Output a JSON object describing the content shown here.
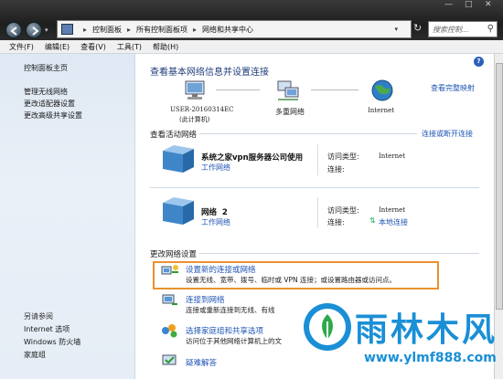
{
  "titlebar": {
    "breadcrumbs": [
      "控制面板",
      "所有控制面板项",
      "网络和共享中心"
    ],
    "search_placeholder": "搜索控制..."
  },
  "menu": [
    "文件(F)",
    "编辑(E)",
    "查看(V)",
    "工具(T)",
    "帮助(H)"
  ],
  "sidebar": {
    "top_links": [
      "控制面板主页",
      "管理无线网络",
      "更改适配器设置",
      "更改高级共享设置"
    ],
    "see_also_title": "另请参阅",
    "see_also_links": [
      "Internet 选项",
      "Windows 防火墙",
      "家庭组"
    ]
  },
  "main": {
    "heading": "查看基本网络信息并设置连接",
    "full_map_link": "查看完整映射",
    "map": {
      "computer_name": "USER-20160314EC",
      "computer_sub": "(此计算机)",
      "network_label": "多重网络",
      "internet_label": "Internet"
    },
    "active_title": "查看活动网络",
    "connect_link": "连接或断开连接",
    "networks": [
      {
        "name": "系统之家vpn服务器公司使用",
        "type_link": "工作网络",
        "access_label": "访问类型:",
        "access_value": "Internet",
        "conn_label": "连接:",
        "conn_value": ""
      },
      {
        "name": "网络  2",
        "type_link": "工作网络",
        "access_label": "访问类型:",
        "access_value": "Internet",
        "conn_label": "连接:",
        "conn_value": "本地连接"
      }
    ],
    "change_title": "更改网络设置",
    "tasks": [
      {
        "title": "设置新的连接或网络",
        "desc": "设置无线、宽带、拨号、临时或 VPN 连接；或设置路由器或访问点。"
      },
      {
        "title": "连接到网络",
        "desc": "连接或重新连接到无线、有线"
      },
      {
        "title": "选择家庭组和共享选项",
        "desc": "访问位于其他网络计算机上的文"
      },
      {
        "title": "疑难解答",
        "desc": ""
      }
    ]
  },
  "watermark": {
    "text": "雨林木风",
    "url": "www.ylmf888.com"
  },
  "colors": {
    "accent_link": "#1f55b4",
    "highlight_border": "#e8932f",
    "watermark": "#1a8fd6"
  }
}
